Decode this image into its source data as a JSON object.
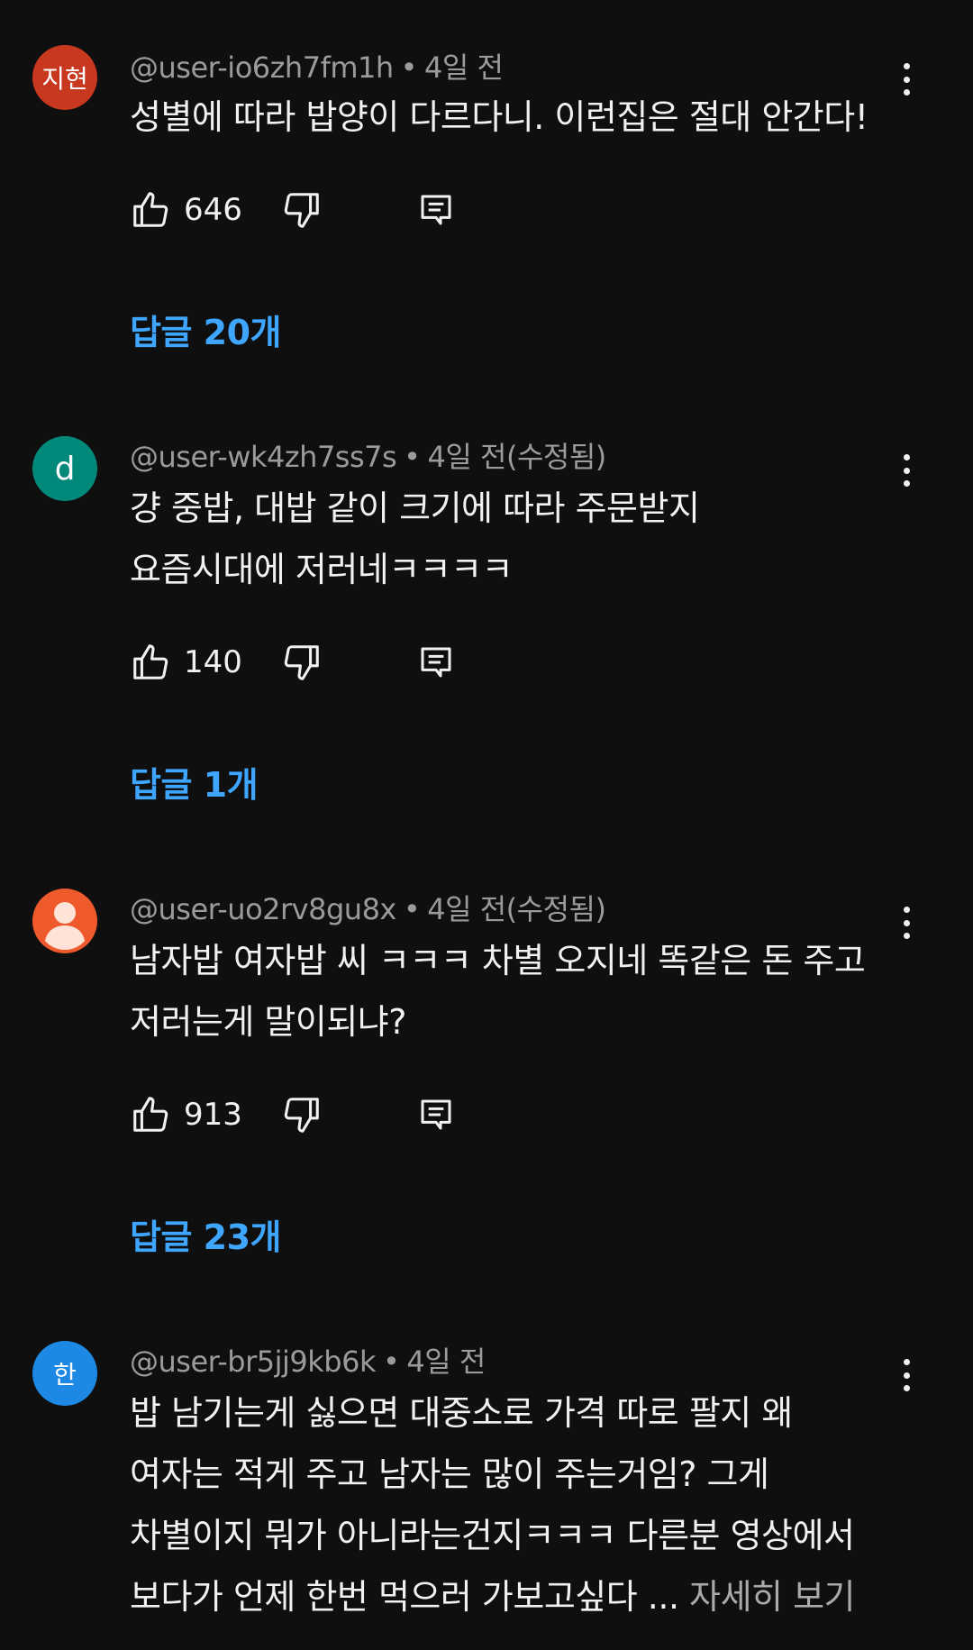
{
  "comments": [
    {
      "avatar_text": "지현",
      "avatar_color": "#c7381f",
      "author": "@user-io6zh7fm1h",
      "time": "4일 전",
      "edited": "",
      "lines": [
        "성별에 따라 밥양이 다르다니.  이런집은 절대 안간다!"
      ],
      "likes": "646",
      "replies": "답글 20개"
    },
    {
      "avatar_text": "d",
      "avatar_color": "#00897b",
      "author": "@user-wk4zh7ss7s",
      "time": "4일 전",
      "edited": "(수정됨)",
      "lines": [
        "걍 중밥, 대밥 같이 크기에 따라 주문받지",
        "요즘시대에 저러네ㅋㅋㅋㅋ"
      ],
      "likes": "140",
      "replies": "답글 1개"
    },
    {
      "avatar_text": "",
      "avatar_icon": "default-user-icon",
      "avatar_color": "#ef5a2d",
      "author": "@user-uo2rv8gu8x",
      "time": "4일 전",
      "edited": "(수정됨)",
      "lines": [
        "남자밥 여자밥 씨 ㅋㅋㅋ 차별 오지네 똑같은 돈 주고",
        "저러는게 말이되냐?"
      ],
      "likes": "913",
      "replies": "답글 23개"
    },
    {
      "avatar_text": "한",
      "avatar_color": "#1e88e5",
      "author": "@user-br5jj9kb6k",
      "time": "4일 전",
      "edited": "",
      "lines": [
        "밥 남기는게 싫으면 대중소로 가격 따로 팔지 왜",
        "여자는 적게 주고 남자는 많이 주는거임? 그게",
        "차별이지 뭐가 아니라는건지ㅋㅋㅋ 다른분 영상에서",
        "보다가 언제 한번 먹으러 가보고싶다 ... "
      ],
      "read_more": "자세히 보기"
    }
  ],
  "separator": "•"
}
